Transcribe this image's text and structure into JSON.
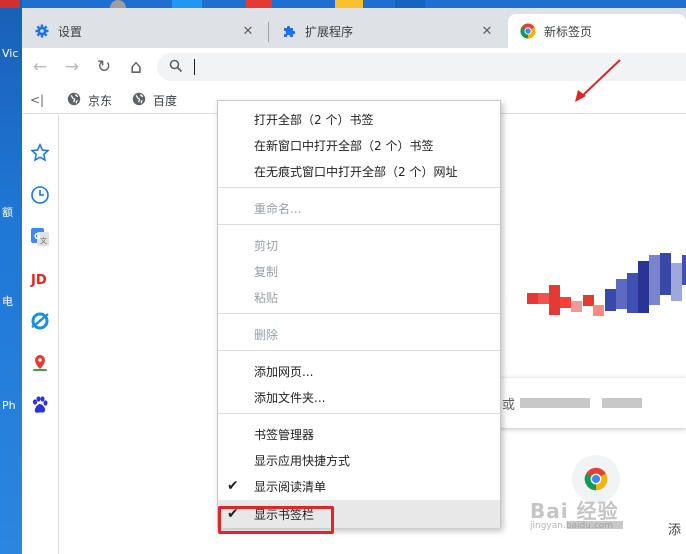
{
  "desktop": {
    "labels": [
      "Vic",
      "额",
      "电",
      "Ph"
    ]
  },
  "tabs": [
    {
      "label": "设置",
      "icon": "gear-icon",
      "close": "✕"
    },
    {
      "label": "扩展程序",
      "icon": "puzzle-icon",
      "close": "✕"
    },
    {
      "label": "新标签页",
      "icon": "chrome-icon",
      "close": ""
    }
  ],
  "toolbar": {
    "back": "←",
    "forward": "→",
    "reload": "↻",
    "home": "⌂"
  },
  "bookmarks_bar": {
    "apps_label": "<|",
    "items": [
      {
        "label": "京东",
        "icon": "globe-icon"
      },
      {
        "label": "百度",
        "icon": "globe-icon"
      }
    ]
  },
  "sidebar": {
    "items": [
      "star-icon",
      "clock-icon",
      "google-translate-icon",
      "jd-icon",
      "browser-icon",
      "maps-icon",
      "baidu-paw-icon"
    ]
  },
  "context_menu": {
    "group1": [
      {
        "label": "打开全部（2 个）书签",
        "enabled": true
      },
      {
        "label": "在新窗口中打开全部（2 个）书签",
        "enabled": true
      },
      {
        "label": "在无痕式窗口中打开全部（2 个）网址",
        "enabled": true
      }
    ],
    "group2": [
      {
        "label": "重命名...",
        "enabled": false
      }
    ],
    "group3": [
      {
        "label": "剪切",
        "enabled": false
      },
      {
        "label": "复制",
        "enabled": false
      },
      {
        "label": "粘贴",
        "enabled": false
      }
    ],
    "group4": [
      {
        "label": "删除",
        "enabled": false
      }
    ],
    "group5": [
      {
        "label": "添加网页...",
        "enabled": true
      },
      {
        "label": "添加文件夹...",
        "enabled": true
      }
    ],
    "group6": [
      {
        "label": "书签管理器",
        "enabled": true,
        "checked": false
      },
      {
        "label": "显示应用快捷方式",
        "enabled": true,
        "checked": false
      },
      {
        "label": "显示阅读清单",
        "enabled": true,
        "checked": true
      },
      {
        "label": "显示书签栏",
        "enabled": true,
        "checked": true,
        "highlighted": true
      }
    ],
    "check_mark": "✔"
  },
  "page": {
    "search_prefix": "或",
    "add_shortcut_label": "添",
    "watermark": "Bai 经验",
    "watermark_sub": "jingyan.baidu.com"
  },
  "colors": {
    "annotation_red": "#e0242a",
    "tabstrip": "#dee1e6",
    "accent_blue": "#1a73e8"
  }
}
